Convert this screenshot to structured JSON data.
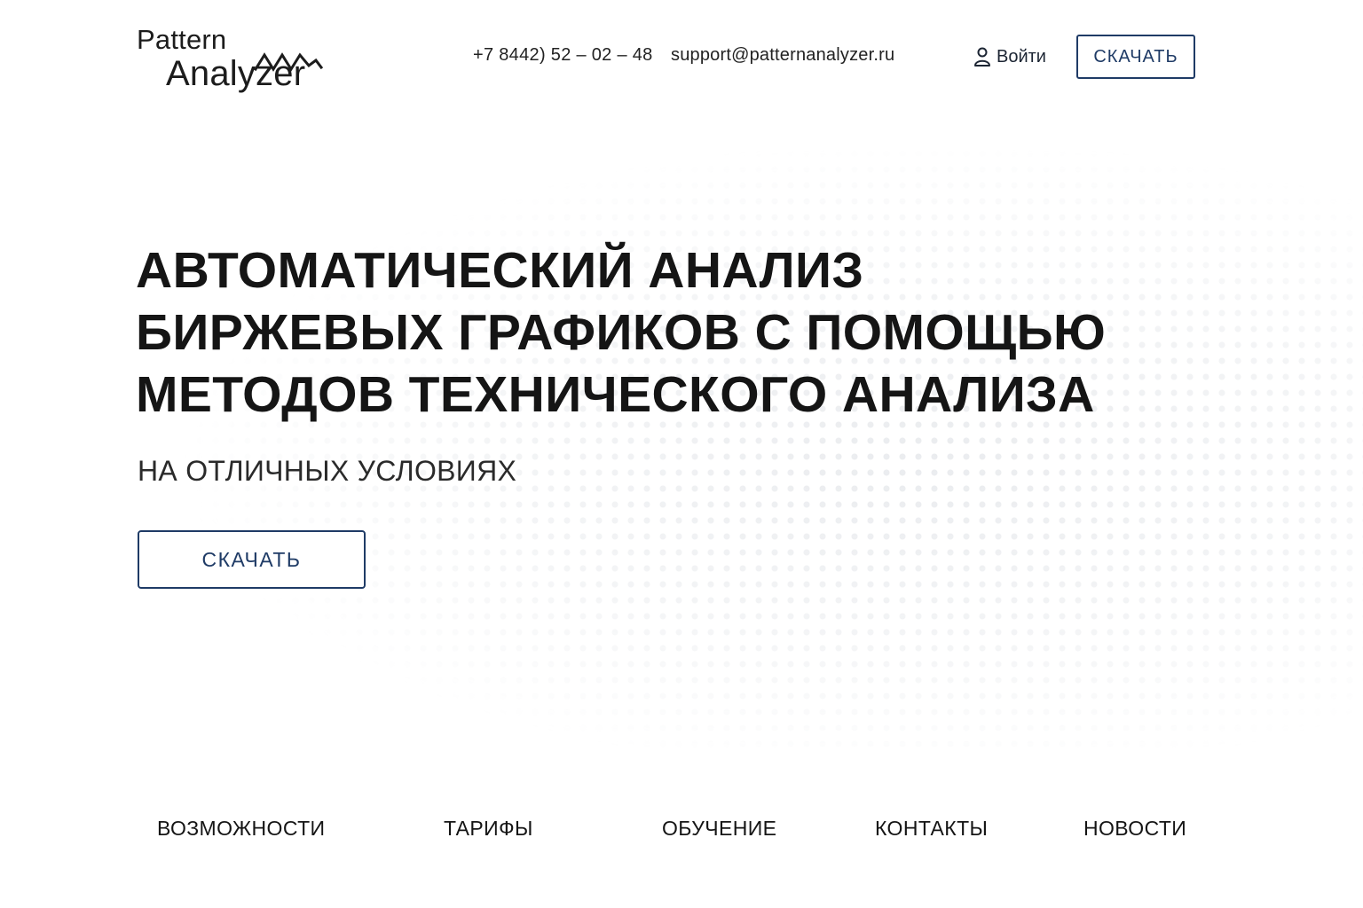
{
  "brand": {
    "name_line1": "Pattern",
    "name_line2": "Analyzer",
    "logo_icon": "zigzag-wave-icon",
    "accent_color": "#1f3b66"
  },
  "header": {
    "phone": "+7 8442) 52 – 02 – 48",
    "email": "support@patternanalyzer.ru",
    "login_label": "Войти",
    "login_icon": "user-icon",
    "download_label": "СКАЧАТЬ"
  },
  "hero": {
    "title_lines": [
      "АВТОМАТИЧЕСКИЙ АНАЛИЗ",
      "БИРЖЕВЫХ ГРАФИКОВ С ПОМОЩЬЮ",
      "МЕТОДОВ ТЕХНИЧЕСКОГО АНАЛИЗА"
    ],
    "subtitle": "НА ОТЛИЧНЫХ УСЛОВИЯХ",
    "download_label": "СКАЧАТЬ"
  },
  "nav": {
    "items": [
      {
        "label": "ВОЗМОЖНОСТИ"
      },
      {
        "label": "ТАРИФЫ"
      },
      {
        "label": "ОБУЧЕНИЕ"
      },
      {
        "label": "КОНТАКТЫ"
      },
      {
        "label": "НОВОСТИ"
      }
    ]
  }
}
